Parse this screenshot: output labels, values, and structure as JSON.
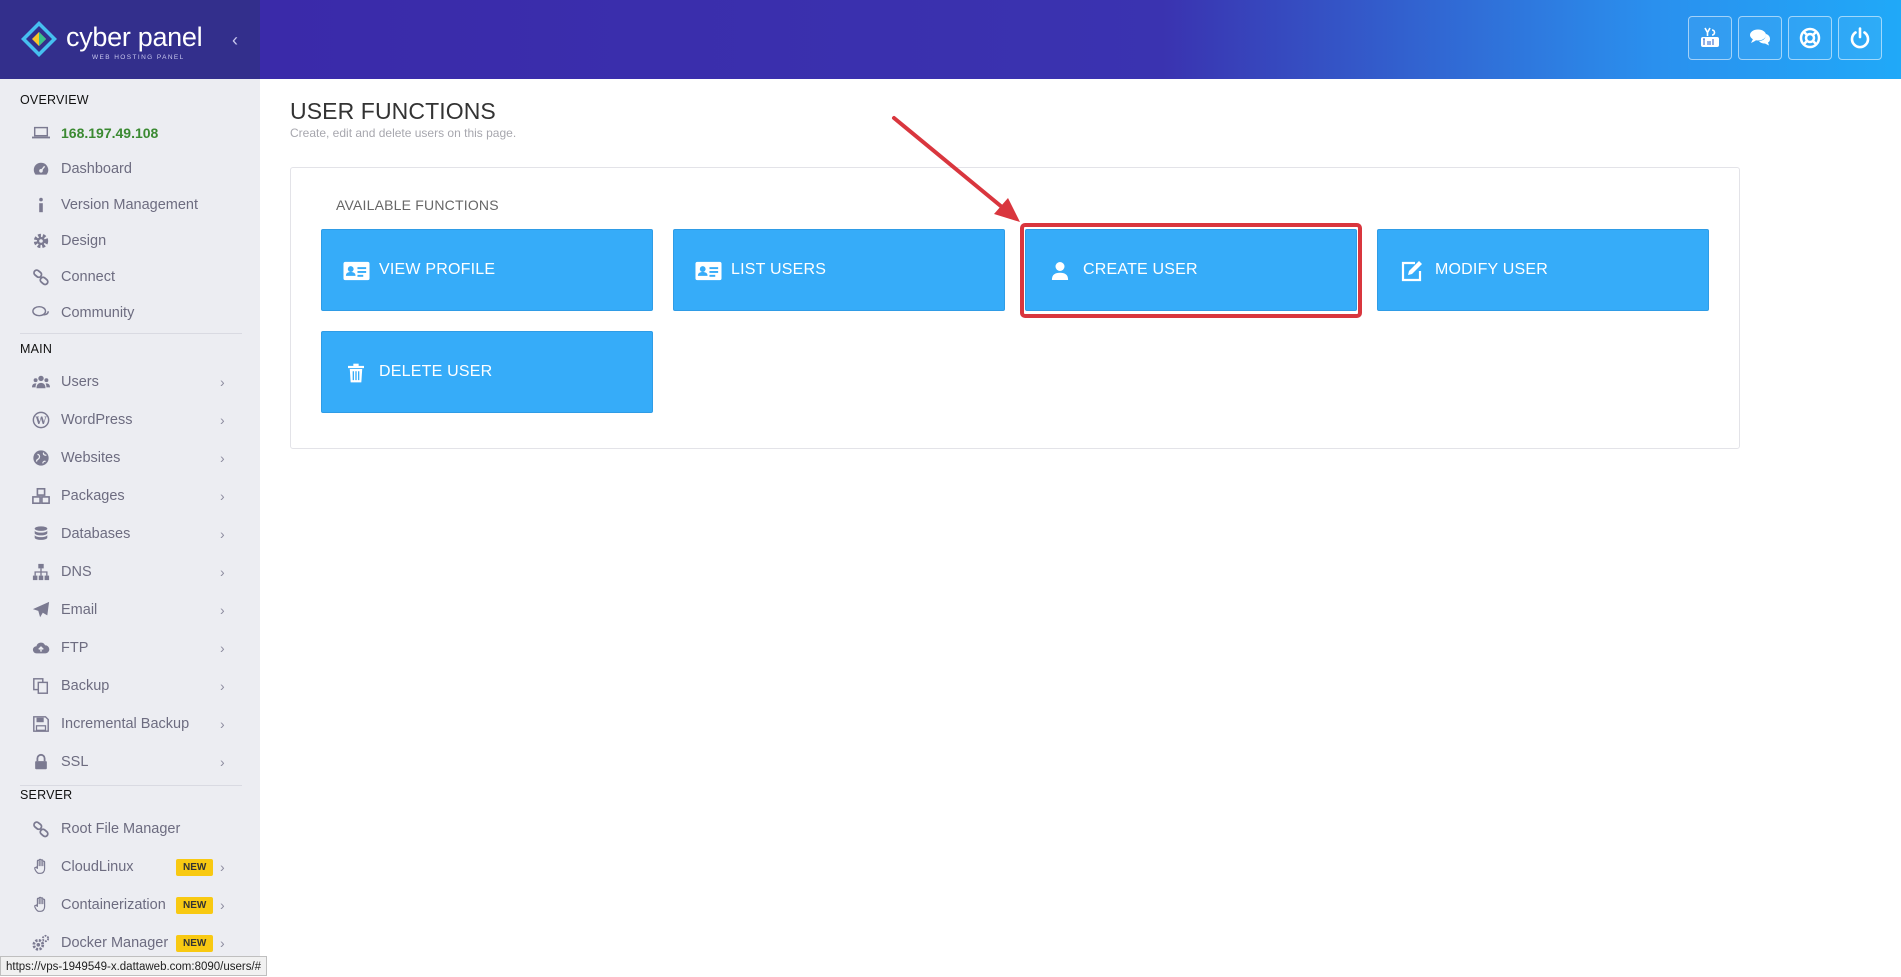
{
  "brand": {
    "name": "cyber panel",
    "subtitle": "WEB HOSTING PANEL"
  },
  "sidebar": {
    "sections": {
      "overview": "OVERVIEW",
      "main": "MAIN",
      "server": "SERVER"
    },
    "ip": "168.197.49.108",
    "overview_items": [
      {
        "label": "Dashboard",
        "icon": "dashboard-icon"
      },
      {
        "label": "Version Management",
        "icon": "info-icon"
      },
      {
        "label": "Design",
        "icon": "gear-icon"
      },
      {
        "label": "Connect",
        "icon": "link-icon"
      },
      {
        "label": "Community",
        "icon": "comments-icon"
      }
    ],
    "main_items": [
      {
        "label": "Users",
        "icon": "users-icon"
      },
      {
        "label": "WordPress",
        "icon": "wordpress-icon"
      },
      {
        "label": "Websites",
        "icon": "globe-icon"
      },
      {
        "label": "Packages",
        "icon": "cubes-icon"
      },
      {
        "label": "Databases",
        "icon": "database-icon"
      },
      {
        "label": "DNS",
        "icon": "sitemap-icon"
      },
      {
        "label": "Email",
        "icon": "paper-plane-icon"
      },
      {
        "label": "FTP",
        "icon": "cloud-upload-icon"
      },
      {
        "label": "Backup",
        "icon": "copy-icon"
      },
      {
        "label": "Incremental Backup",
        "icon": "save-icon"
      },
      {
        "label": "SSL",
        "icon": "lock-icon"
      }
    ],
    "server_items": [
      {
        "label": "Root File Manager",
        "icon": "link-icon"
      },
      {
        "label": "CloudLinux",
        "icon": "hand-icon",
        "badge": "NEW"
      },
      {
        "label": "Containerization",
        "icon": "hand-icon",
        "badge": "NEW"
      },
      {
        "label": "Docker Manager",
        "icon": "gears-icon",
        "badge": "NEW"
      }
    ],
    "chevron": "›"
  },
  "topbar": {
    "buttons": [
      "youtube-icon",
      "chat-icon",
      "life-ring-icon",
      "power-icon"
    ]
  },
  "page": {
    "title": "USER FUNCTIONS",
    "subtitle": "Create, edit and delete users on this page."
  },
  "panel": {
    "title": "AVAILABLE FUNCTIONS",
    "buttons": [
      {
        "label": "VIEW PROFILE",
        "icon": "id-card-icon"
      },
      {
        "label": "LIST USERS",
        "icon": "id-card-icon"
      },
      {
        "label": "CREATE USER",
        "icon": "user-icon"
      },
      {
        "label": "MODIFY USER",
        "icon": "edit-icon"
      },
      {
        "label": "DELETE USER",
        "icon": "trash-icon"
      }
    ]
  },
  "status_url": "https://vps-1949549-x.dattaweb.com:8090/users/#",
  "colors": {
    "sidebar_bg": "#ecedf2",
    "brand_bg": "#332f8c",
    "button_bg": "#36acf9",
    "highlight": "#d9363e",
    "ip_text": "#3b8a32",
    "badge": "#f8c912"
  }
}
